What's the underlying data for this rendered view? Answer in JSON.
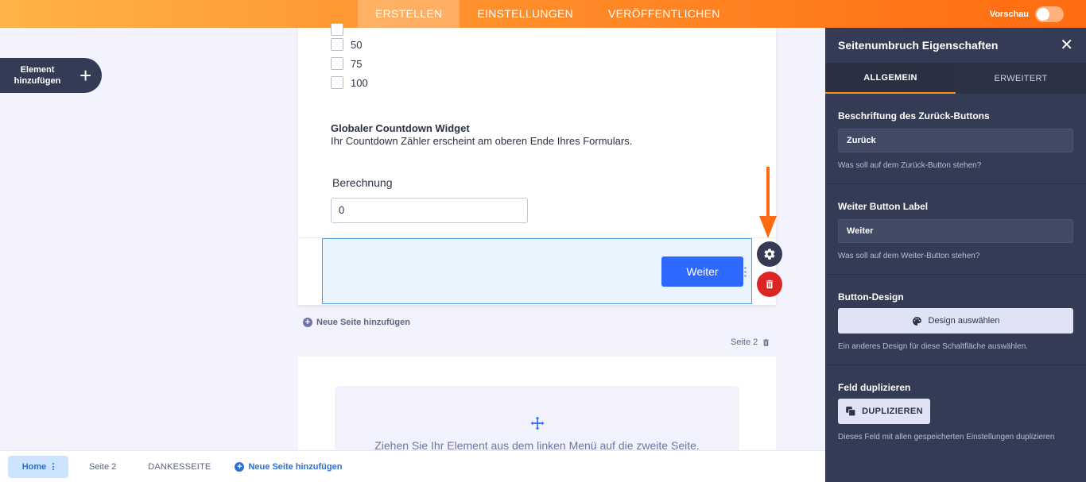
{
  "topbar": {
    "tabs": [
      {
        "label": "ERSTELLEN"
      },
      {
        "label": "EINSTELLUNGEN"
      },
      {
        "label": "VERÖFFENTLICHEN"
      }
    ],
    "preview_label": "Vorschau"
  },
  "add_element": {
    "label": "Element hinzufügen"
  },
  "form": {
    "options": [
      "50",
      "75",
      "100"
    ],
    "widget_title": "Globaler Countdown Widget",
    "widget_desc": "Ihr Countdown Zähler erscheint am oberen Ende Ihres Formulars.",
    "calc_label": "Berechnung",
    "calc_value": "0",
    "next_button": "Weiter",
    "add_page": "Neue Seite hinzufügen",
    "page2_label": "Seite 2",
    "drop_text": "Ziehen Sie Ihr Element aus dem linken Menü auf die zweite Seite."
  },
  "bottombar": {
    "home": "Home",
    "seite2": "Seite 2",
    "thanks": "DANKESSEITE",
    "add_page": "Neue Seite hinzufügen"
  },
  "panel": {
    "title": "Seitenumbruch Eigenschaften",
    "tabs": [
      {
        "label": "ALLGEMEIN"
      },
      {
        "label": "ERWEITERT"
      }
    ],
    "back_label": "Beschriftung des Zurück-Buttons",
    "back_value": "Zurück",
    "back_help": "Was soll auf dem Zurück-Button stehen?",
    "next_label": "Weiter Button Label",
    "next_value": "Weiter",
    "next_help": "Was soll auf dem Weiter-Button stehen?",
    "design_label": "Button-Design",
    "design_button": "Design auswählen",
    "design_help": "Ein anderes Design für diese Schaltfläche auswählen.",
    "dup_label": "Feld duplizieren",
    "dup_button": "DUPLIZIEREN",
    "dup_help": "Dieses Feld mit allen gespeicherten Einstellungen duplizieren"
  },
  "colors": {
    "accent": "#ff7f1f",
    "primary_button": "#2e69ff",
    "panel_bg": "#343c55",
    "danger": "#dc2626"
  }
}
